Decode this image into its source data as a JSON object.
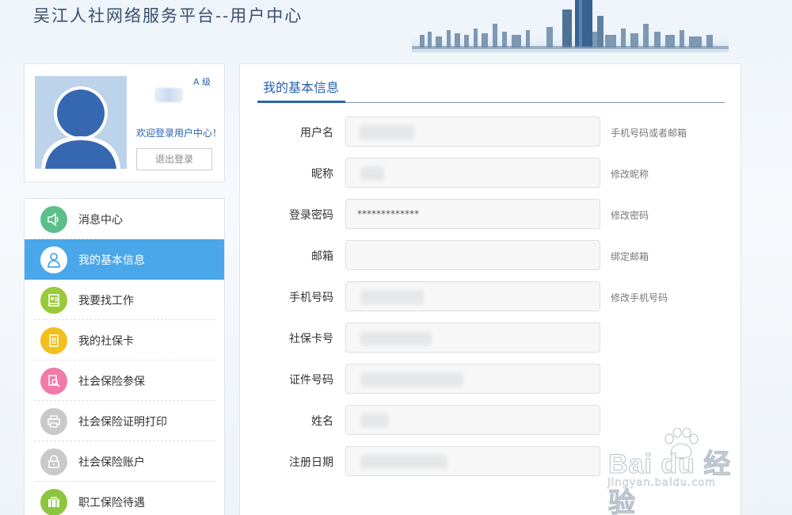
{
  "header": {
    "site_title": "吴江人社网络服务平台--用户中心"
  },
  "profile": {
    "level": "A 级",
    "welcome": "欢迎登录用户中心！",
    "logout_label": "退出登录"
  },
  "nav": {
    "items": [
      {
        "label": "消息中心",
        "icon": "speaker-icon",
        "color": "#5cbf8a"
      },
      {
        "label": "我的基本信息",
        "icon": "user-icon",
        "color": "#ffffff",
        "active": true
      },
      {
        "label": "我要找工作",
        "icon": "resume-icon",
        "color": "#9bc93c"
      },
      {
        "label": "我的社保卡",
        "icon": "card-icon",
        "color": "#f2bf1c"
      },
      {
        "label": "社会保险参保",
        "icon": "search-doc-icon",
        "color": "#f07aa8"
      },
      {
        "label": "社会保险证明打印",
        "icon": "printer-icon",
        "color": "#c9c9c9"
      },
      {
        "label": "社会保险账户",
        "icon": "lock-icon",
        "color": "#c9c9c9"
      },
      {
        "label": "职工保险待遇",
        "icon": "briefcase-icon",
        "color": "#8cc63e"
      }
    ]
  },
  "panel": {
    "title": "我的基本信息",
    "fields": [
      {
        "label": "用户名",
        "value": "",
        "hint": "手机号码或者邮箱"
      },
      {
        "label": "昵称",
        "value": "",
        "hint": "修改昵称"
      },
      {
        "label": "登录密码",
        "value": "*************",
        "hint": "修改密码"
      },
      {
        "label": "邮箱",
        "value": "",
        "hint": "绑定邮箱"
      },
      {
        "label": "手机号码",
        "value": "",
        "hint": "修改手机号码"
      },
      {
        "label": "社保卡号",
        "value": "",
        "hint": ""
      },
      {
        "label": "证件号码",
        "value": "",
        "hint": ""
      },
      {
        "label": "姓名",
        "value": "",
        "hint": ""
      },
      {
        "label": "注册日期",
        "value": "",
        "hint": ""
      }
    ]
  },
  "watermark": {
    "brand": "Bai du 经验",
    "url": "jingyan.baidu.com"
  },
  "colors": {
    "accent": "#2a63b0",
    "nav_active": "#4aa7ea"
  }
}
